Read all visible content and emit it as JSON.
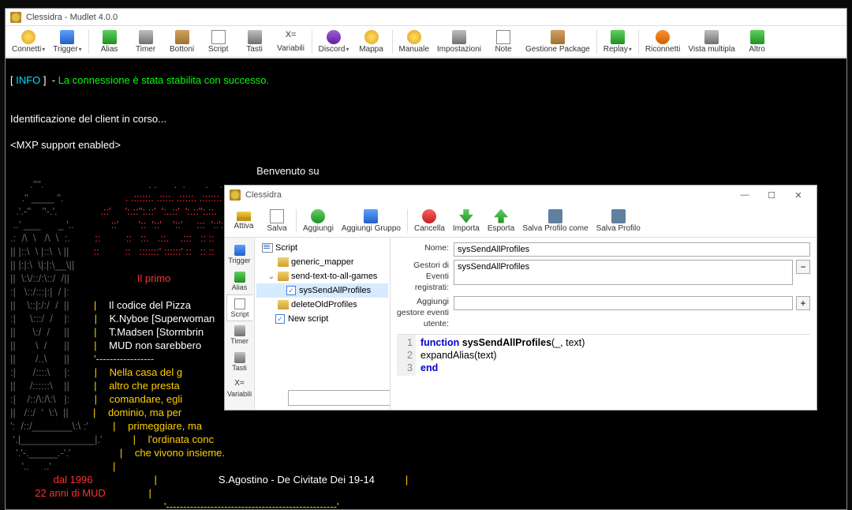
{
  "main": {
    "title": "Clessidra - Mudlet 4.0.0",
    "toolbar": [
      {
        "label": "Connetti",
        "ico": "i-yellow",
        "chev": true
      },
      {
        "label": "Trigger",
        "ico": "i-blue",
        "chev": true
      },
      {
        "label": "Alias",
        "ico": "i-green"
      },
      {
        "label": "Timer",
        "ico": "i-gray"
      },
      {
        "label": "Bottoni",
        "ico": "i-box"
      },
      {
        "label": "Script",
        "ico": "i-doc"
      },
      {
        "label": "Tasti",
        "ico": "i-gray"
      },
      {
        "label": "Variabili",
        "text": "X="
      },
      {
        "label": "Discord",
        "ico": "i-purple",
        "chev": true
      },
      {
        "label": "Mappa",
        "ico": "i-yellow"
      },
      {
        "label": "Manuale",
        "ico": "i-yellow"
      },
      {
        "label": "Impostazioni",
        "ico": "i-gray"
      },
      {
        "label": "Note",
        "ico": "i-doc"
      },
      {
        "label": "Gestione Package",
        "ico": "i-box"
      },
      {
        "label": "Replay",
        "ico": "i-green",
        "chev": true
      },
      {
        "label": "Riconnetti",
        "ico": "i-orange"
      },
      {
        "label": "Vista multipla",
        "ico": "i-gray"
      },
      {
        "label": "Altro",
        "ico": "i-green"
      }
    ]
  },
  "console": {
    "info_prefix": "[ ",
    "info_tag": "INFO",
    "info_suffix": " ]  - ",
    "info_msg": "La connessione è stata stabilita con successo.",
    "ident": "Identificazione del client in corso...",
    "mxp": "<MXP support enabled>",
    "welcome": "Benvenuto su",
    "primo": "Il primo ",
    "codice": "Il codice del Pizza",
    "k1": "K.Nyboe [Superwoman",
    "k2": "T.Madsen [Stormbrin",
    "k3": "MUD non sarebbero ",
    "casa1": "Nella casa del g",
    "casa2": "altro che presta",
    "casa3": "comandare, egli",
    "casa4": "dominio, ma per",
    "casa5": "primeggiare, ma",
    "casa6": "l'ordinata conc",
    "casa7": "che vivono insieme.",
    "dal": "dal 1996",
    "anni": "22 anni di MUD",
    "agostino": "S.Agostino - De Civitate Dei 19-14"
  },
  "dialog": {
    "title": "Clessidra",
    "toolbar": {
      "attiva": "Attiva",
      "salva": "Salva",
      "aggiungi": "Aggiungi",
      "aggiungi_gruppo": "Aggiungi Gruppo",
      "cancella": "Cancella",
      "importa": "Importa",
      "esporta": "Esporta",
      "salva_profilo_come": "Salva Profilo come",
      "salva_profilo": "Salva Profilo"
    },
    "sidetabs": [
      "Trigger",
      "Alias",
      "Script",
      "Timer",
      "Tasti",
      "Variabili"
    ],
    "tree": {
      "root": "Script",
      "items": [
        {
          "label": "generic_mapper",
          "type": "folder",
          "depth": 1
        },
        {
          "label": "send-text-to-all-games",
          "type": "folder",
          "depth": 1,
          "expanded": true
        },
        {
          "label": "sysSendAllProfiles",
          "type": "check",
          "depth": 2,
          "selected": true
        },
        {
          "label": "deleteOldProfiles",
          "type": "folder",
          "depth": 1
        },
        {
          "label": "New script",
          "type": "check",
          "depth": 1
        }
      ]
    },
    "form": {
      "nome_label": "Nome:",
      "nome_value": "sysSendAllProfiles",
      "gestori_label": "Gestori di Eventi registrati:",
      "gestori_value": "sysSendAllProfiles",
      "aggiungi_label": "Aggiungi gestore eventi utente:"
    },
    "code": {
      "l1_kw": "function",
      "l1_fn": "sysSendAllProfiles",
      "l1_rest": "(_, text)",
      "l2": "   expandAlias(text)",
      "l3": "end"
    }
  }
}
